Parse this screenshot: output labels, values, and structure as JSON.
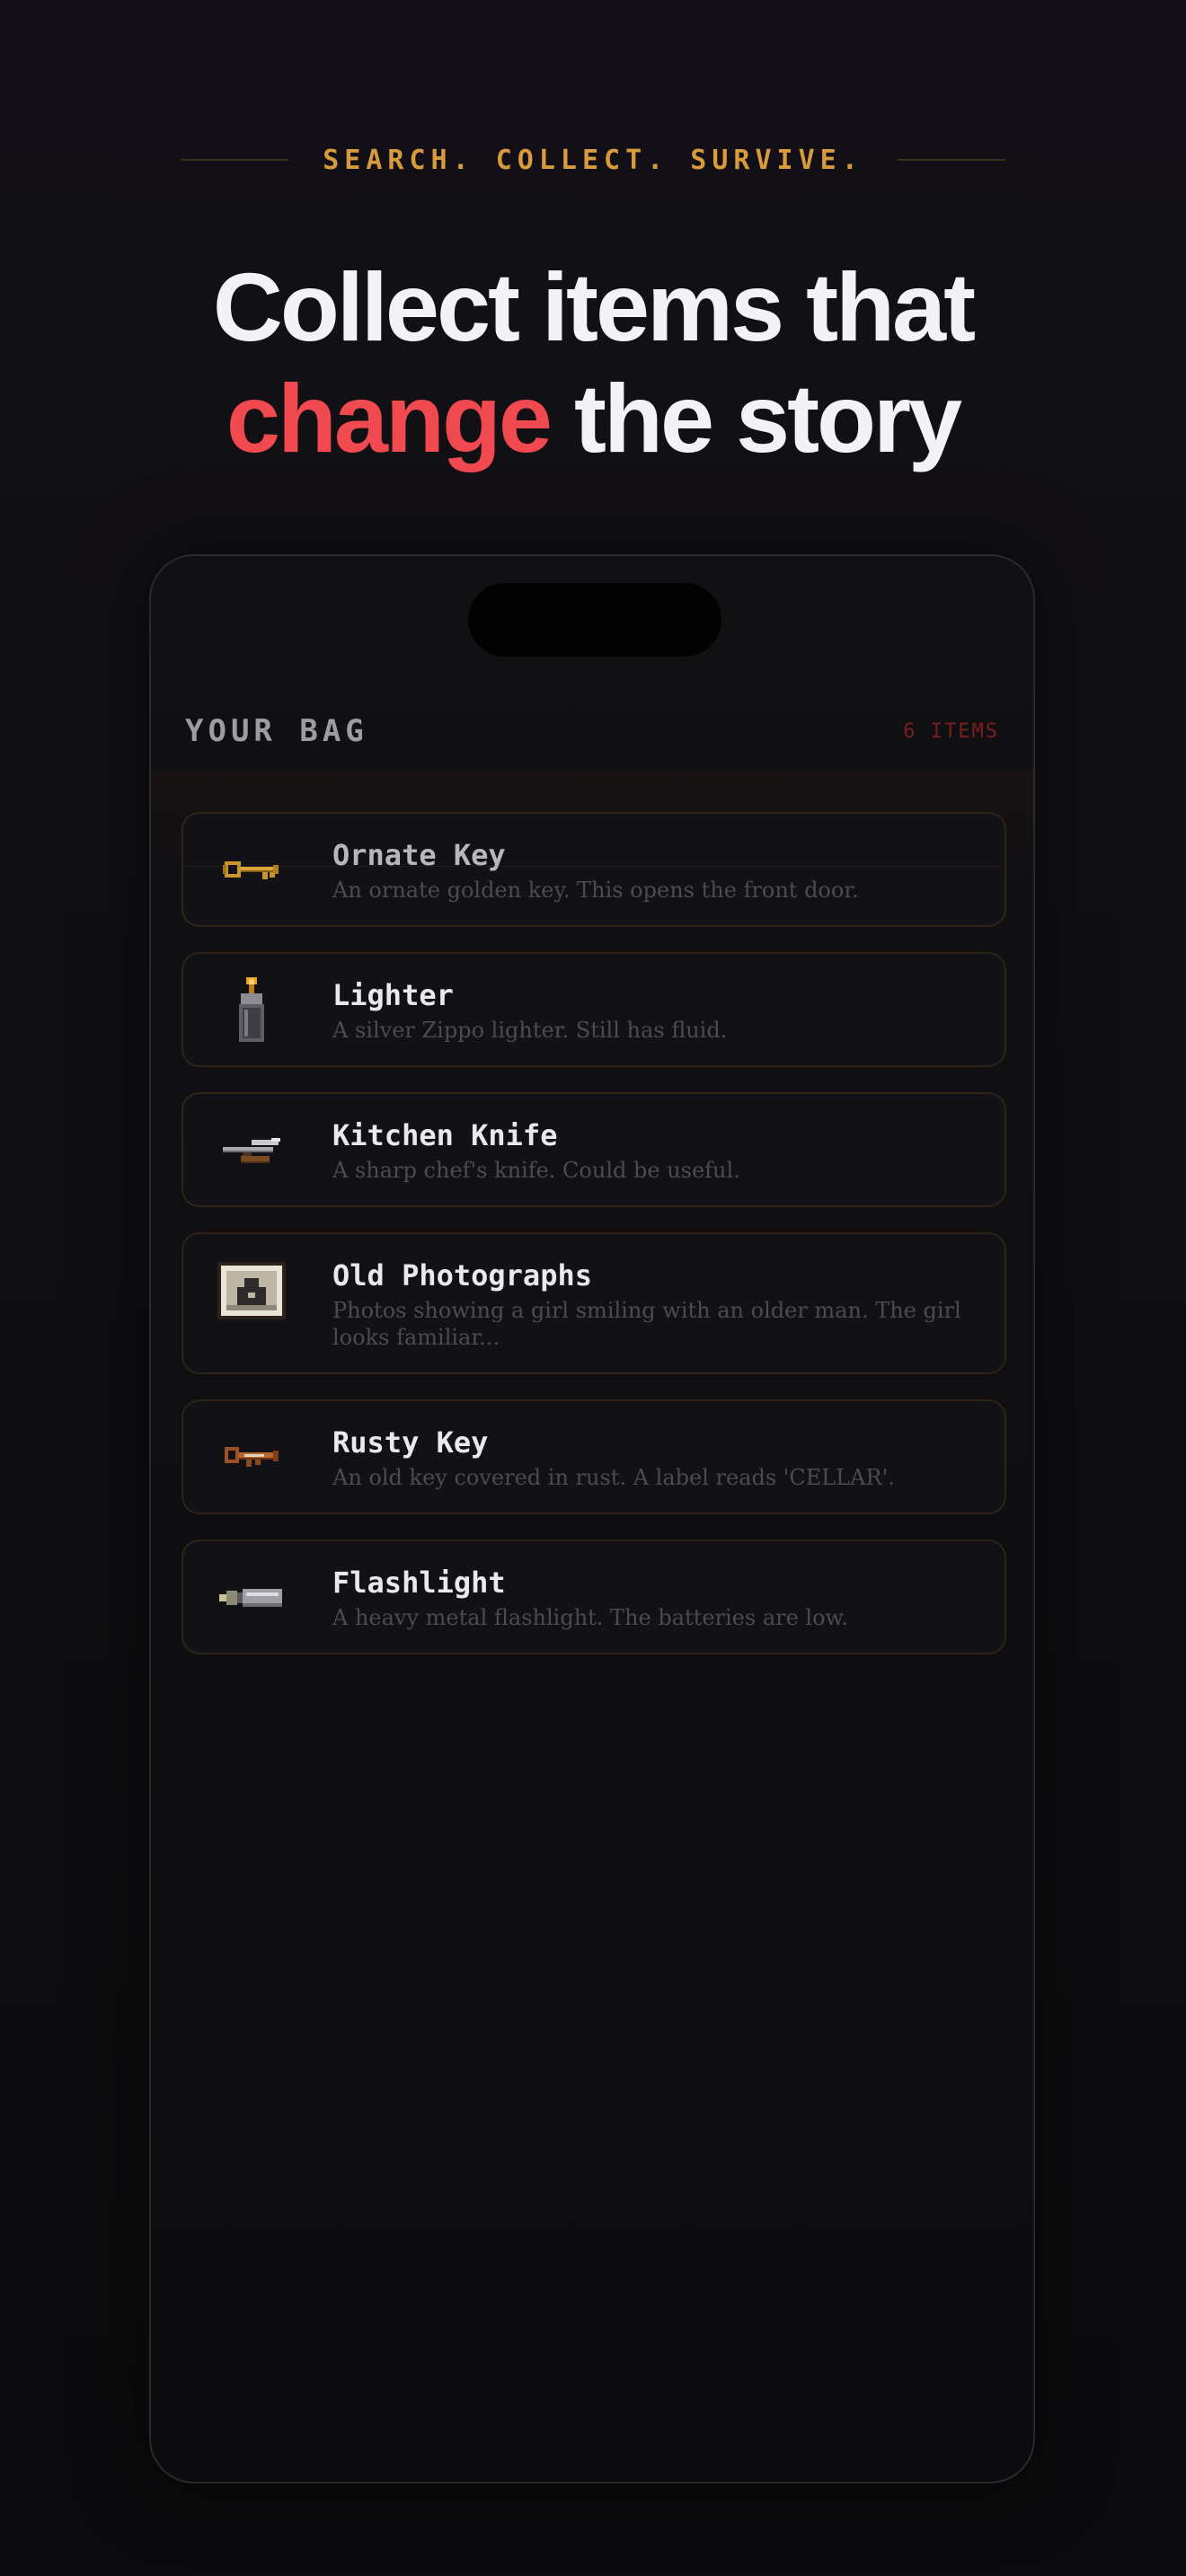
{
  "header": {
    "tagline": "SEARCH. COLLECT. SURVIVE.",
    "headline_line1": "Collect items that",
    "headline_accent": "change",
    "headline_rest": " the story"
  },
  "bag": {
    "title": "YOUR BAG",
    "count_label": "6 ITEMS"
  },
  "items": [
    {
      "name": "Ornate Key",
      "description": "An ornate golden key. This opens the front door.",
      "icon": "ornate-key-icon"
    },
    {
      "name": "Lighter",
      "description": "A silver Zippo lighter. Still has fluid.",
      "icon": "lighter-icon"
    },
    {
      "name": "Kitchen Knife",
      "description": "A sharp chef's knife. Could be useful.",
      "icon": "knife-icon"
    },
    {
      "name": "Old Photographs",
      "description": "Photos showing a girl smiling with an older man. The girl looks familiar...",
      "icon": "photograph-icon"
    },
    {
      "name": "Rusty Key",
      "description": "An old key covered in rust. A label reads 'CELLAR'.",
      "icon": "rusty-key-icon"
    },
    {
      "name": "Flashlight",
      "description": "A heavy metal flashlight. The batteries are low.",
      "icon": "flashlight-icon"
    }
  ],
  "colors": {
    "accent_red": "#f0494f",
    "tagline_gold": "#d79a3c",
    "item_border": "#2d2417",
    "count_red": "#7a1f1f"
  }
}
